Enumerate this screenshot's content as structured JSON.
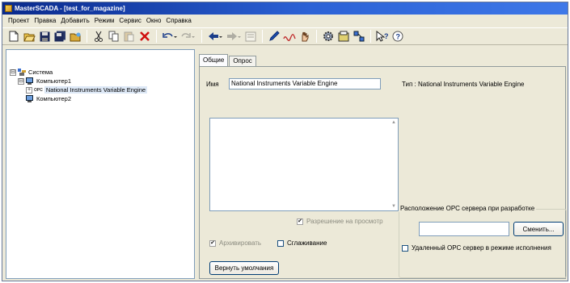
{
  "window": {
    "title": "MasterSCADA - [test_for_magazine]"
  },
  "menu": [
    "Проект",
    "Правка",
    "Добавить",
    "Режим",
    "Сервис",
    "Окно",
    "Справка"
  ],
  "toolbar": {
    "buttons": [
      "new-icon",
      "open-icon",
      "save-icon",
      "save-all-icon",
      "open-folder-icon",
      "cut-icon",
      "copy-icon",
      "paste-icon",
      "delete-icon",
      "undo-icon",
      "redo-icon",
      "back-icon",
      "forward-icon",
      "properties-icon",
      "pen-icon",
      "link-icon",
      "hand-icon",
      "settings-icon",
      "object-icon",
      "network-icon",
      "context-help-icon",
      "help-icon"
    ]
  },
  "tree": {
    "root": {
      "label": "Система",
      "expander": "⊟"
    },
    "computer1": {
      "label": "Компьютер1",
      "expander": "⊟"
    },
    "opc": {
      "label": "National Instruments Variable Engine",
      "expander": "+",
      "badge": "OPC"
    },
    "computer2": {
      "label": "Компьютер2"
    }
  },
  "tabs": [
    {
      "label": "Общие",
      "active": true
    },
    {
      "label": "Опрос",
      "active": false
    }
  ],
  "general": {
    "name_label": "Имя",
    "name_value": "National Instruments Variable Engine",
    "type_text": "Тип : National Instruments Variable Engine",
    "allow_view_label": "Разрешение на просмотр",
    "allow_view_checked": true,
    "archive_label": "Архивировать",
    "archive_checked": true,
    "smoothing_label": "Сглаживание",
    "smoothing_checked": false,
    "restore_defaults_label": "Вернуть умолчания",
    "opc_location_title": "Расположение OPC сервера при разработке",
    "opc_location_value": "",
    "change_button_label": "Сменить...",
    "remote_opc_label": "Удаленный OPC сервер в режиме исполнения",
    "remote_opc_checked": false
  }
}
